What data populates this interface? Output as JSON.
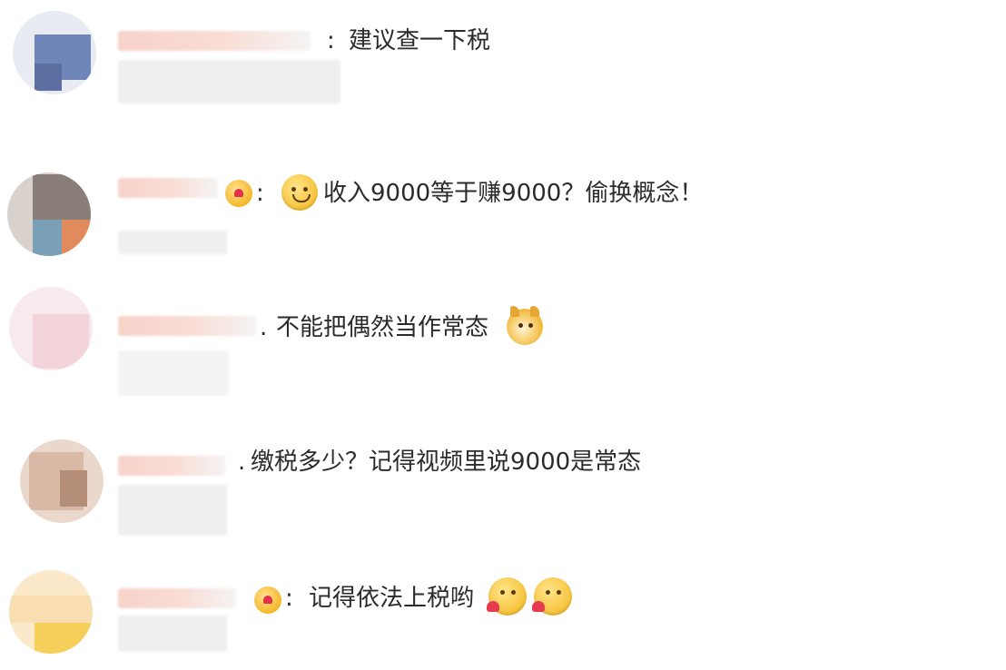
{
  "comments": [
    {
      "user": "",
      "separator": ":",
      "text": "建议查一下税",
      "emoji_after": []
    },
    {
      "user": "",
      "separator": ":",
      "text": "收入9000等于赚9000？偷换概念！",
      "badge_icon": "heart-badge-icon",
      "emoji_before": "smirk-emoji-icon"
    },
    {
      "user": "",
      "separator": ".",
      "text": "不能把偶然当作常态",
      "emoji_after": [
        "doge-emoji-icon"
      ]
    },
    {
      "user": "",
      "separator": ".",
      "text": "缴税多少？记得视频里说9000是常态",
      "emoji_after": []
    },
    {
      "user": "",
      "separator": ":",
      "text": "记得依法上税哟",
      "badge_icon": "heart-badge-icon",
      "emoji_after": [
        "heart-hands-emoji-icon",
        "heart-hands-emoji-icon"
      ]
    }
  ]
}
